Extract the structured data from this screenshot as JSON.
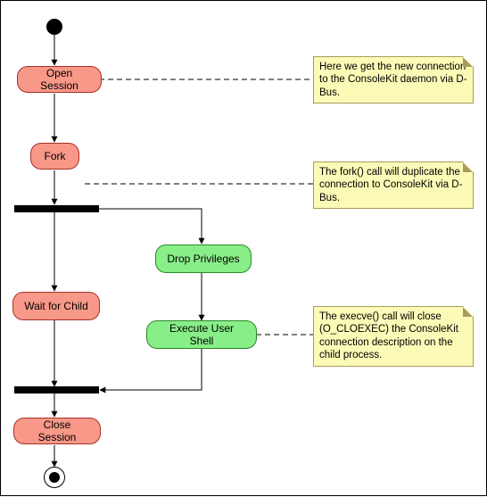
{
  "chart_data": {
    "type": "activity-diagram",
    "nodes": [
      {
        "id": "start",
        "kind": "initial"
      },
      {
        "id": "open_session",
        "kind": "activity",
        "lane": "main",
        "color": "red",
        "label": "Open Session"
      },
      {
        "id": "fork",
        "kind": "activity",
        "lane": "main",
        "color": "red",
        "label": "Fork"
      },
      {
        "id": "forkbar",
        "kind": "fork"
      },
      {
        "id": "wait_child",
        "kind": "activity",
        "lane": "parent",
        "color": "red",
        "label": "Wait for Child"
      },
      {
        "id": "drop_priv",
        "kind": "activity",
        "lane": "child",
        "color": "green",
        "label": "Drop Privileges"
      },
      {
        "id": "exec_shell",
        "kind": "activity",
        "lane": "child",
        "color": "green",
        "label": "Execute User Shell"
      },
      {
        "id": "joinbar",
        "kind": "join"
      },
      {
        "id": "close_session",
        "kind": "activity",
        "lane": "main",
        "color": "red",
        "label": "Close Session"
      },
      {
        "id": "end",
        "kind": "final"
      }
    ],
    "edges": [
      [
        "start",
        "open_session"
      ],
      [
        "open_session",
        "fork"
      ],
      [
        "fork",
        "forkbar"
      ],
      [
        "forkbar",
        "wait_child"
      ],
      [
        "forkbar",
        "drop_priv"
      ],
      [
        "drop_priv",
        "exec_shell"
      ],
      [
        "wait_child",
        "joinbar"
      ],
      [
        "exec_shell",
        "joinbar"
      ],
      [
        "joinbar",
        "close_session"
      ],
      [
        "close_session",
        "end"
      ]
    ],
    "notes": [
      {
        "attached_to": "open_session",
        "text": "Here we get the new connection to the ConsoleKit daemon via D-Bus."
      },
      {
        "attached_to": "forkbar",
        "text": "The fork() call will duplicate the connection to ConsoleKit via D-Bus."
      },
      {
        "attached_to": "exec_shell",
        "text": "The execve() call will close (O_CLOEXEC) the ConsoleKit connection description on the child process."
      }
    ]
  },
  "labels": {
    "open_session": "Open Session",
    "fork": "Fork",
    "wait_child": "Wait for Child",
    "drop_priv": "Drop Privileges",
    "exec_shell": "Execute User Shell",
    "close_session": "Close Session"
  },
  "notes": {
    "n1": "Here we get the new connection to the ConsoleKit daemon via D-Bus.",
    "n2": "The fork() call will duplicate the connection to ConsoleKit via D-Bus.",
    "n3": "The execve() call will close (O_CLOEXEC) the ConsoleKit connection description on the child process."
  }
}
